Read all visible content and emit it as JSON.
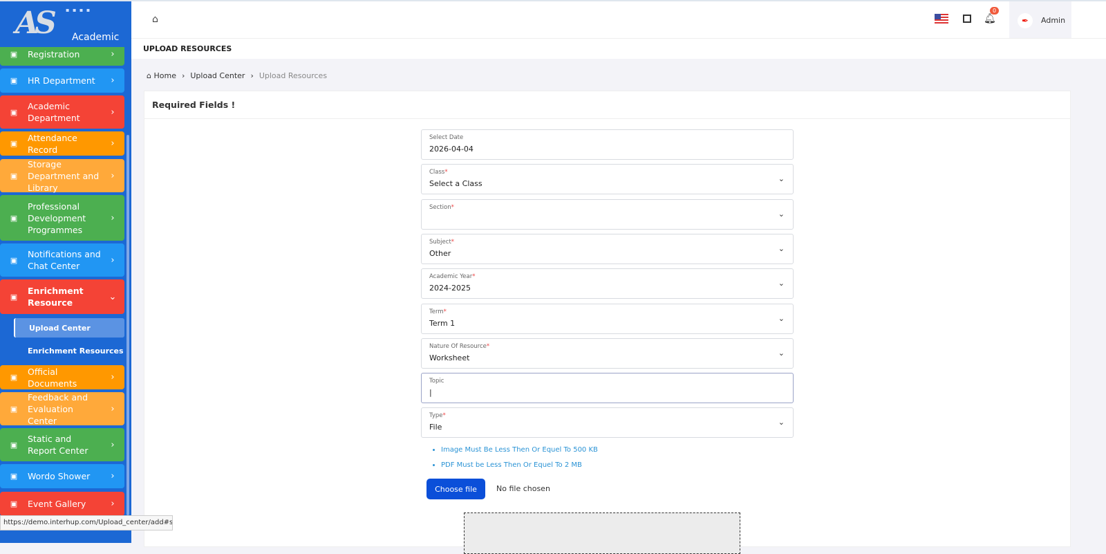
{
  "logo": {
    "text": "Academic",
    "mark": "AS"
  },
  "sidebar": {
    "items": [
      {
        "label": "Registration",
        "color": "#4caf50",
        "icon": "registration-icon"
      },
      {
        "label": "HR Department",
        "color": "#2196f3",
        "icon": "user-circle-icon"
      },
      {
        "label": "Academic Department",
        "color": "#f44336",
        "icon": "graduation-cap-icon"
      },
      {
        "label": "Attendance Record",
        "color": "#ff9800",
        "icon": "calendar-check-icon"
      },
      {
        "label": "Storage Department and Library",
        "color": "#ffa93a",
        "icon": "calendar-icon"
      },
      {
        "label": "Professional Development Programmes",
        "color": "#4caf50",
        "icon": "newspaper-icon"
      },
      {
        "label": "Notifications and Chat Center",
        "color": "#2196f3",
        "icon": "bell-icon"
      },
      {
        "label": "Enrichment Resource",
        "color": "#f44336",
        "icon": "book-open-icon"
      },
      {
        "label": "Official Documents",
        "color": "#ff9800",
        "icon": "document-icon"
      },
      {
        "label": "Feedback and Evaluation Center",
        "color": "#ffa93a",
        "icon": "document-icon"
      },
      {
        "label": "Static and Report Center",
        "color": "#4caf50",
        "icon": "document-icon"
      },
      {
        "label": "Wordo Shower",
        "color": "#2196f3",
        "icon": "document-icon"
      },
      {
        "label": "Event Gallery",
        "color": "#f44336",
        "icon": "document-icon"
      }
    ],
    "subitems": [
      {
        "label": "Upload Center"
      },
      {
        "label": "Enrichment Resources"
      }
    ]
  },
  "header": {
    "notifications": "0",
    "user": "Admin"
  },
  "page": {
    "title": "UPLOAD RESOURCES",
    "breadcrumb": [
      "Home",
      "Upload Center",
      "Upload Resources"
    ],
    "card_title": "Required Fields !"
  },
  "form": {
    "fields": [
      {
        "label": "Select Date",
        "required": false,
        "value": "2026-04-04",
        "select": false
      },
      {
        "label": "Class",
        "required": true,
        "value": "Select a Class",
        "select": true
      },
      {
        "label": "Section",
        "required": true,
        "value": "",
        "select": true
      },
      {
        "label": "Subject",
        "required": true,
        "value": "Other",
        "select": true
      },
      {
        "label": "Academic Year",
        "required": true,
        "value": "2024-2025",
        "select": true
      },
      {
        "label": "Term",
        "required": true,
        "value": "Term 1",
        "select": true
      },
      {
        "label": "Nature Of Resource",
        "required": true,
        "value": "Worksheet",
        "select": true
      },
      {
        "label": "Topic",
        "required": false,
        "value": "|",
        "select": false
      },
      {
        "label": "Type",
        "required": true,
        "value": "File",
        "select": true
      }
    ],
    "notes": [
      "Image Must Be Less Then Or Equel To 500 KB",
      "PDF Must be Less Then Or Equel To 2 MB"
    ],
    "choose_file": "Choose file",
    "no_file": "No file chosen"
  },
  "statusbar": "https://demo.interhup.com/Upload_center/add#sic"
}
